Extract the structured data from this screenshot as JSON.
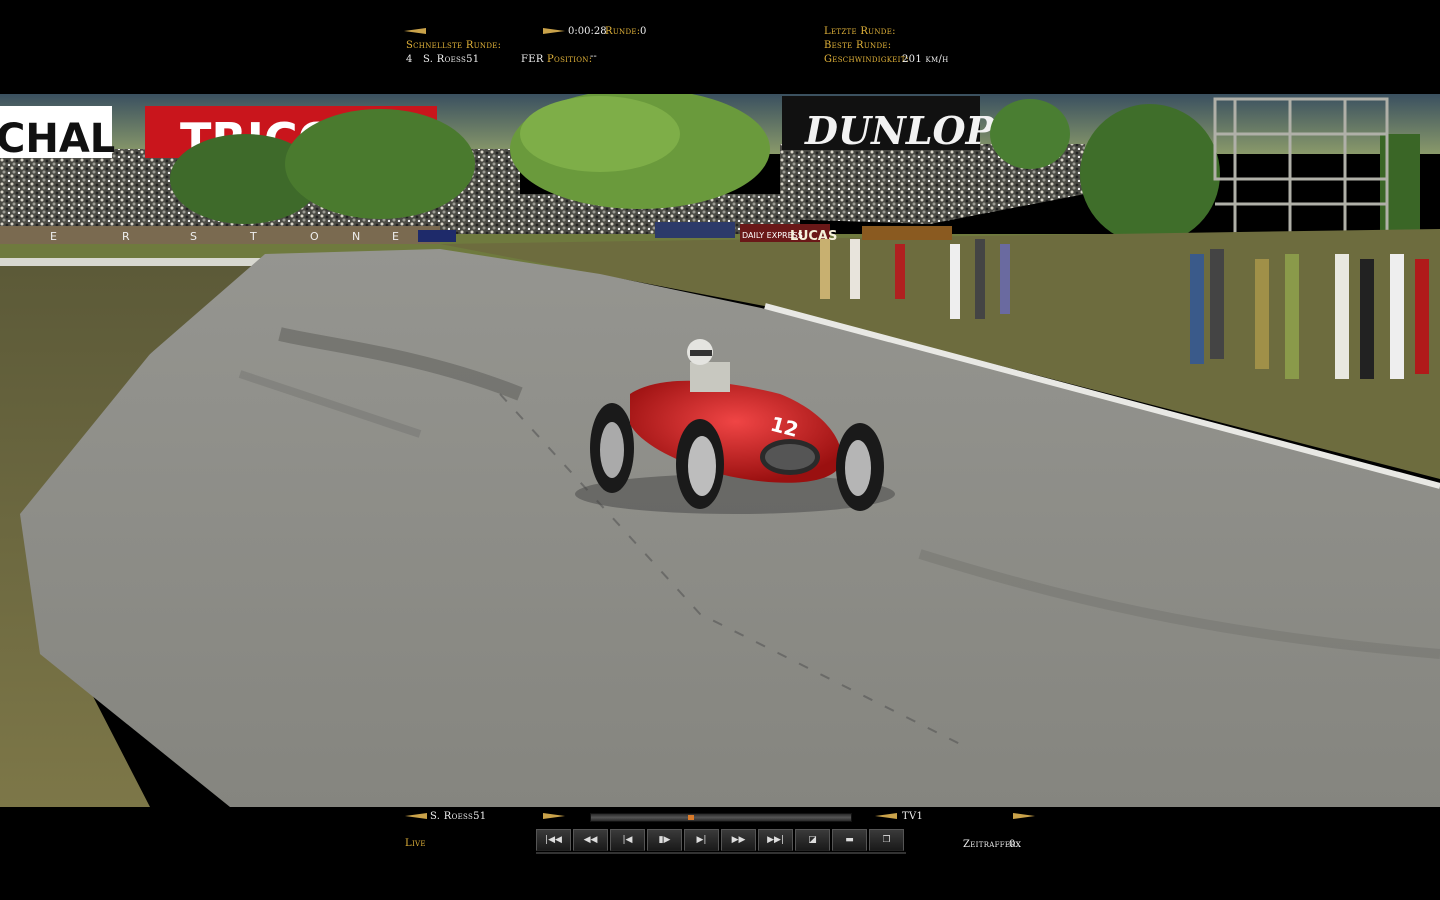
{
  "top_hud": {
    "fastest_lap_label": "Schnellste Runde:",
    "fastest_lap_pos": "4",
    "fastest_lap_driver": "S. Roess51",
    "fastest_lap_team": "FER",
    "time": "0:00:28",
    "lap_label": "Runde:",
    "lap_value": "0",
    "position_label": "Position:",
    "position_value": "--",
    "last_lap_label": "Letzte Runde:",
    "best_lap_label": "Beste Runde:",
    "speed_label": "Geschwindigkeit:",
    "speed_value": "201 km/h"
  },
  "scene": {
    "banners": [
      "CHAL",
      "TRICO",
      "DUNLOP",
      "LUCAS",
      "DAILY EXPRESS"
    ],
    "track_letters": [
      "E",
      "R",
      "S",
      "T",
      "O",
      "N",
      "E"
    ],
    "car_number": "12"
  },
  "bottom_hud": {
    "driver": "S. Roess51",
    "live_label": "Live",
    "camera": "TV1",
    "timelapse_label": "Zeitraffer",
    "timelapse_value": "0x",
    "replay_progress": 0.38
  },
  "controls": [
    {
      "name": "skip-to-start-button",
      "glyph": "|◀◀"
    },
    {
      "name": "rewind-button",
      "glyph": "◀◀"
    },
    {
      "name": "step-back-button",
      "glyph": "|◀"
    },
    {
      "name": "play-pause-button",
      "glyph": "▮▶"
    },
    {
      "name": "step-forward-button",
      "glyph": "▶|"
    },
    {
      "name": "fast-forward-button",
      "glyph": "▶▶"
    },
    {
      "name": "skip-to-end-button",
      "glyph": "▶▶|"
    },
    {
      "name": "camera-mode-button",
      "glyph": "◪"
    },
    {
      "name": "marker-button",
      "glyph": "▬"
    },
    {
      "name": "window-button",
      "glyph": "❐"
    }
  ],
  "colors": {
    "hud_gold": "#e3b43a",
    "car_red": "#c8181c",
    "track": "#8c8c87",
    "grass": "#6f6b42"
  }
}
